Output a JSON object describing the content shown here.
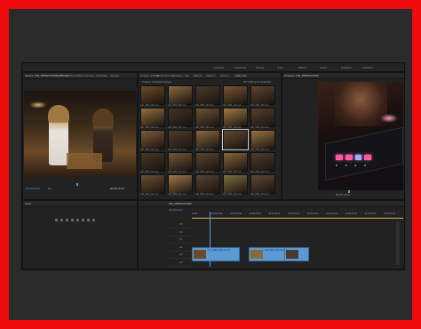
{
  "workspace": {
    "tabs": [
      "Learning",
      "Assembly",
      "Editing",
      "Color",
      "Effects",
      "Audio",
      "Graphics",
      "Libraries"
    ],
    "active_tab": "Editing"
  },
  "source_panel": {
    "title": "Source: 040_M8SHOOTER_150.mov",
    "tabs": [
      "Audio Clip Mixer",
      "Effect Controls",
      "Metadata",
      "Scopes"
    ],
    "timecode_in": "00:00:01:02",
    "timecode_out": "00:00:10:12",
    "fit_label": "Fit"
  },
  "project_panel": {
    "tabs": [
      "Project: Untitled",
      "Media Browser",
      "Libraries",
      "Info",
      "Effects",
      "Markers",
      "History",
      "Audio Clip"
    ],
    "path": "Project: Untitled\\Footage",
    "item_count": "54 of 98 items selected",
    "clips": [
      {
        "name": "040_M8S_001.mov",
        "dur": "5:12"
      },
      {
        "name": "040_M8S_002.mov",
        "dur": "6:02"
      },
      {
        "name": "040_M8S_003.mov",
        "dur": "3:18"
      },
      {
        "name": "040_M8S_004.mov",
        "dur": "4:09"
      },
      {
        "name": "040_M8S_005.mov",
        "dur": "2:20"
      },
      {
        "name": "040_M8S_006.mov",
        "dur": "5:01"
      },
      {
        "name": "040_M8S_007.mov",
        "dur": "3:11"
      },
      {
        "name": "040_M8S_008.mov",
        "dur": "4:15"
      },
      {
        "name": "040_M8S_009.mov",
        "dur": "6:22"
      },
      {
        "name": "040_M8S_010.mov",
        "dur": "2:08"
      },
      {
        "name": "040_M8S_011.mov",
        "dur": "3:19"
      },
      {
        "name": "040_M8S_012.mov",
        "dur": "4:00"
      },
      {
        "name": "040_M8S_013.mov",
        "dur": "5:14"
      },
      {
        "name": "040_M8S_014.mov",
        "dur": "2:27"
      },
      {
        "name": "040_M8S_015.mov",
        "dur": "3:05"
      },
      {
        "name": "040_M8S_016.mov",
        "dur": "4:21"
      },
      {
        "name": "040_M8S_017.mov",
        "dur": "5:09"
      },
      {
        "name": "040_M8S_018.mov",
        "dur": "3:26"
      },
      {
        "name": "040_M8S_019.mov",
        "dur": "2:13"
      },
      {
        "name": "040_M8S_020.mov",
        "dur": "4:18"
      },
      {
        "name": "040_M8S_021.mov",
        "dur": "6:00"
      },
      {
        "name": "040_M8S_022.mov",
        "dur": "3:02"
      },
      {
        "name": "040_M8S_023.mov",
        "dur": "5:24"
      },
      {
        "name": "040_M8S_024.mov",
        "dur": "4:06"
      },
      {
        "name": "040_M8S_025.mov",
        "dur": "2:16"
      }
    ],
    "colors": [
      "#6b4a2a",
      "#8a6a3a",
      "#4a3a2a",
      "#7a5632",
      "#5c4630",
      "#93703f",
      "#3f3426",
      "#6e5234",
      "#a07a44",
      "#54412c",
      "#7d5c36",
      "#4d3e2e",
      "#8c6940",
      "#62492f",
      "#9b7545",
      "#463828",
      "#75583a",
      "#5a452f",
      "#88673d",
      "#4f3f2d",
      "#6a5035",
      "#9e7848",
      "#57442f",
      "#807040",
      "#5e4a33"
    ]
  },
  "program_panel": {
    "title": "Program: 040_M8SHOOTER",
    "timecode_in": "00:00:00:00",
    "timecode_out": "00:00:12:04",
    "fit_label": "Fit",
    "pad_values": [
      "8",
      "8",
      "8",
      "8"
    ]
  },
  "tools_panel": {
    "title": "Tools"
  },
  "timeline": {
    "sequence_tab": "040_M8SHOOTER",
    "timecode": "00:00:03:07",
    "ruler_marks": [
      "00:00",
      "00:00:02:00",
      "00:00:04:00",
      "00:00:06:00",
      "00:00:08:00",
      "00:00:10:00",
      "00:00:12:00",
      "00:00:14:00",
      "00:00:16:00",
      "00:00:18:00",
      "00:00:20:00"
    ],
    "tracks": [
      "V3",
      "V2",
      "V1",
      "A1",
      "A2",
      "A3"
    ],
    "clips_v1": [
      {
        "label": "040_M8S_006.mov [V]"
      },
      {
        "label": "040_M8S_012.mov [V]"
      },
      {
        "label": "040_M8S_021.mov"
      }
    ]
  }
}
